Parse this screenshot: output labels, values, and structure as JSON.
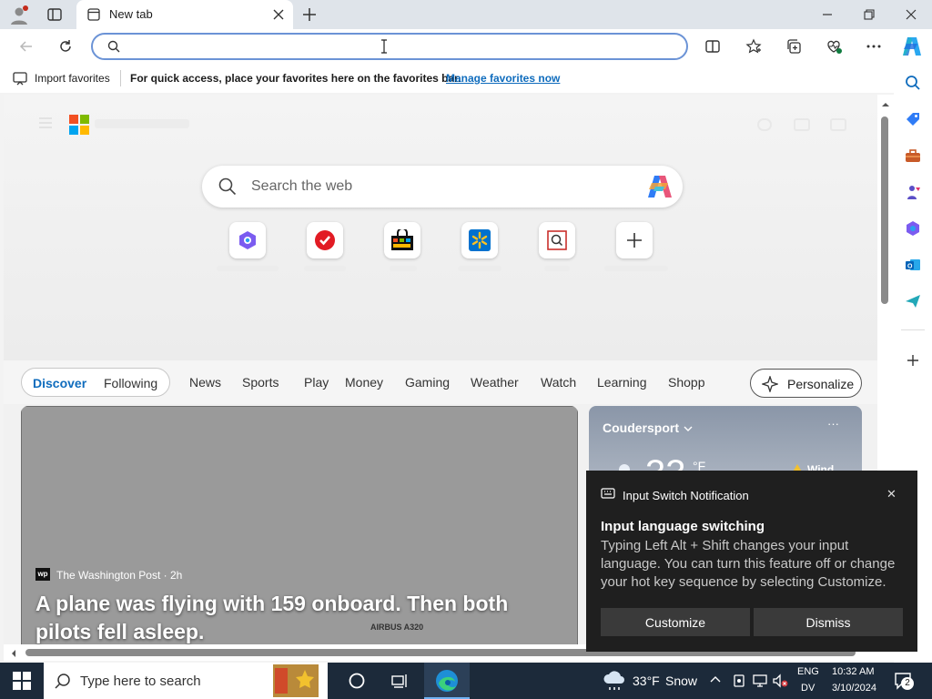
{
  "browser": {
    "tab_title": "New tab",
    "address_value": "",
    "favorites_bar": {
      "import_label": "Import favorites",
      "hint": "For quick access, place your favorites here on the favorites bar.",
      "manage_link": "Manage favorites now"
    }
  },
  "newtab": {
    "search_placeholder": "Search the web",
    "feed_tabs": [
      "Discover",
      "Following"
    ],
    "nav_links": [
      "News",
      "Sports",
      "Play",
      "Money",
      "Gaming",
      "Weather",
      "Watch",
      "Learning",
      "Shopp"
    ],
    "personalize_label": "Personalize",
    "hero_story": {
      "source": "The Washington Post · 2h",
      "headline": "A plane was flying with 159 onboard. Then both pilots fell asleep.",
      "image_text": "AIRBUS A320"
    },
    "weather": {
      "location": "Coudersport",
      "temp": "33",
      "unit": "°F",
      "alert": "Wind",
      "more_label": "···"
    }
  },
  "notification": {
    "app_title": "Input Switch Notification",
    "heading": "Input language switching",
    "body": "Typing Left Alt + Shift changes your input language. You can turn this feature off or change your hot key sequence by selecting Customize.",
    "customize_label": "Customize",
    "dismiss_label": "Dismiss",
    "close_glyph": "✕"
  },
  "taskbar": {
    "search_placeholder": "Type here to search",
    "weather_temp": "33°F",
    "weather_cond": "Snow",
    "lang_top": "ENG",
    "lang_bottom": "DV",
    "time": "10:32 AM",
    "date": "3/10/2024",
    "notif_count": "2"
  },
  "colors": {
    "accent": "#0f6cbd",
    "link": "#0f6cbd",
    "taskbar": "#1c2a3a"
  }
}
